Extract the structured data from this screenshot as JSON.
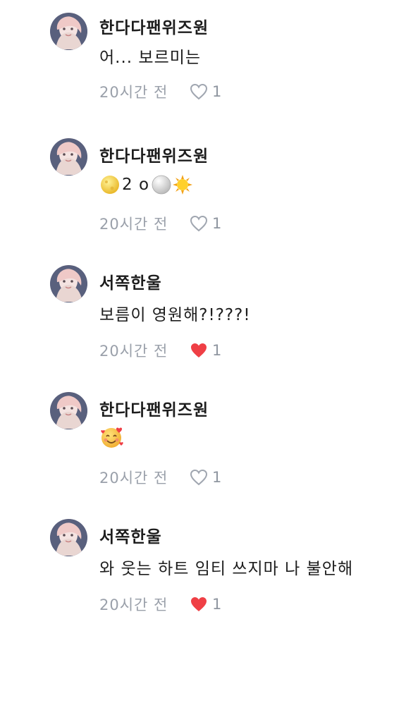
{
  "comments": [
    {
      "username": "한다다팬위즈원",
      "text": "어... 보르미는",
      "time": "20시간 전",
      "liked": false,
      "likes": "1"
    },
    {
      "username": "한다다팬위즈원",
      "text": "2 o",
      "time": "20시간 전",
      "liked": false,
      "likes": "1",
      "emojis": [
        "crescent-moon-icon",
        "full-moon-icon",
        "sun-icon"
      ]
    },
    {
      "username": "서쪽한울",
      "text": "보름이 영원해?!???!",
      "time": "20시간 전",
      "liked": true,
      "likes": "1"
    },
    {
      "username": "한다다팬위즈원",
      "text": "",
      "time": "20시간 전",
      "liked": false,
      "likes": "1",
      "emojis": [
        "smiling-face-with-hearts-icon"
      ]
    },
    {
      "username": "서쪽한울",
      "text": "와 웃는 하트 임티 쓰지마 나 불안해",
      "time": "20시간 전",
      "liked": true,
      "likes": "1"
    }
  ],
  "colors": {
    "meta": "#9aa0aa",
    "heart_outline": "#a0a6b0",
    "heart_filled": "#ef3f45"
  }
}
